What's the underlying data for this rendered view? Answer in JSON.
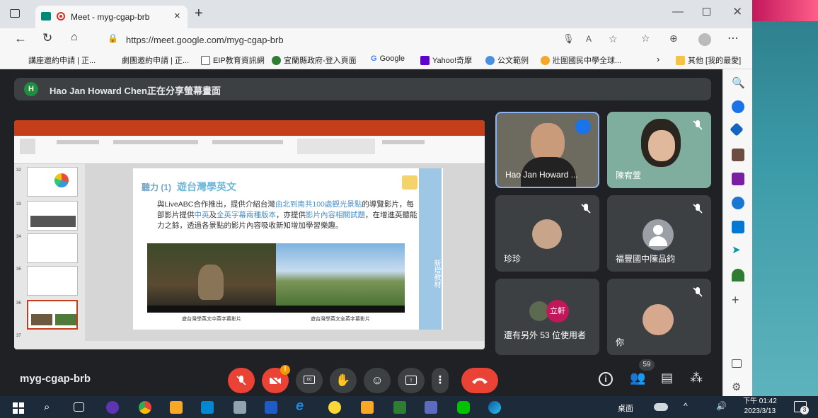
{
  "browser": {
    "tab_title": "Meet - myg-cgap-brb",
    "url": "https://meet.google.com/myg-cgap-brb",
    "bookmarks": [
      {
        "label": "講座邀約申請 | 正..."
      },
      {
        "label": "劇團邀約申請 | 正..."
      },
      {
        "label": "EIP教育資訊網"
      },
      {
        "label": "宜蘭縣政府-登入頁面"
      },
      {
        "label": "Google"
      },
      {
        "label": "Yahoo!奇摩"
      },
      {
        "label": "公文範例"
      },
      {
        "label": "壯圍國民中學全球..."
      },
      {
        "label": "其他 [我的最愛]"
      }
    ]
  },
  "meet": {
    "presenting_banner": "Hao Jan Howard Chen正在分享螢幕畫面",
    "banner_avatar_letter": "H",
    "meeting_code": "myg-cgap-brb",
    "participant_count": "59",
    "slide": {
      "label": "聽力 (1)",
      "heading": "遊台灣學英文",
      "body_1": "與LiveABC合作推出，提供介紹台灣",
      "body_hl_1": "由北到南共100處觀光景點",
      "body_2": "的導覽影片，每部影片提供",
      "body_hl_2": "中英",
      "body_3": "及",
      "body_hl_3": "全英字幕兩種版本",
      "body_4": "，亦提供",
      "body_hl_4": "影片內容相關試題",
      "body_5": "，在增進英聽能力之餘，透過各景點的影片內容吸收新知增加學習樂趣。",
      "caption_1": "遊台灣學英文中英字幕影片",
      "caption_2": "遊台灣學英文全英字幕影片",
      "side_panel": "新增教材"
    },
    "tiles": [
      {
        "name": "Hao Jan Howard ..."
      },
      {
        "name": "陳宥萱"
      },
      {
        "name": "珍珍"
      },
      {
        "name": "福豐國中陳品鈞"
      },
      {
        "name": "還有另外 53 位使用者",
        "badge": "立軒"
      },
      {
        "name": "你"
      }
    ]
  },
  "taskbar": {
    "desktop_label": "桌面",
    "time": "下午 01:42",
    "date": "2023/3/13",
    "notif_count": "3"
  },
  "colors": {
    "meet_bg": "#202124",
    "tile_bg": "#3c4043",
    "hangup_red": "#ea4335",
    "active_border": "#8ab4f8"
  }
}
